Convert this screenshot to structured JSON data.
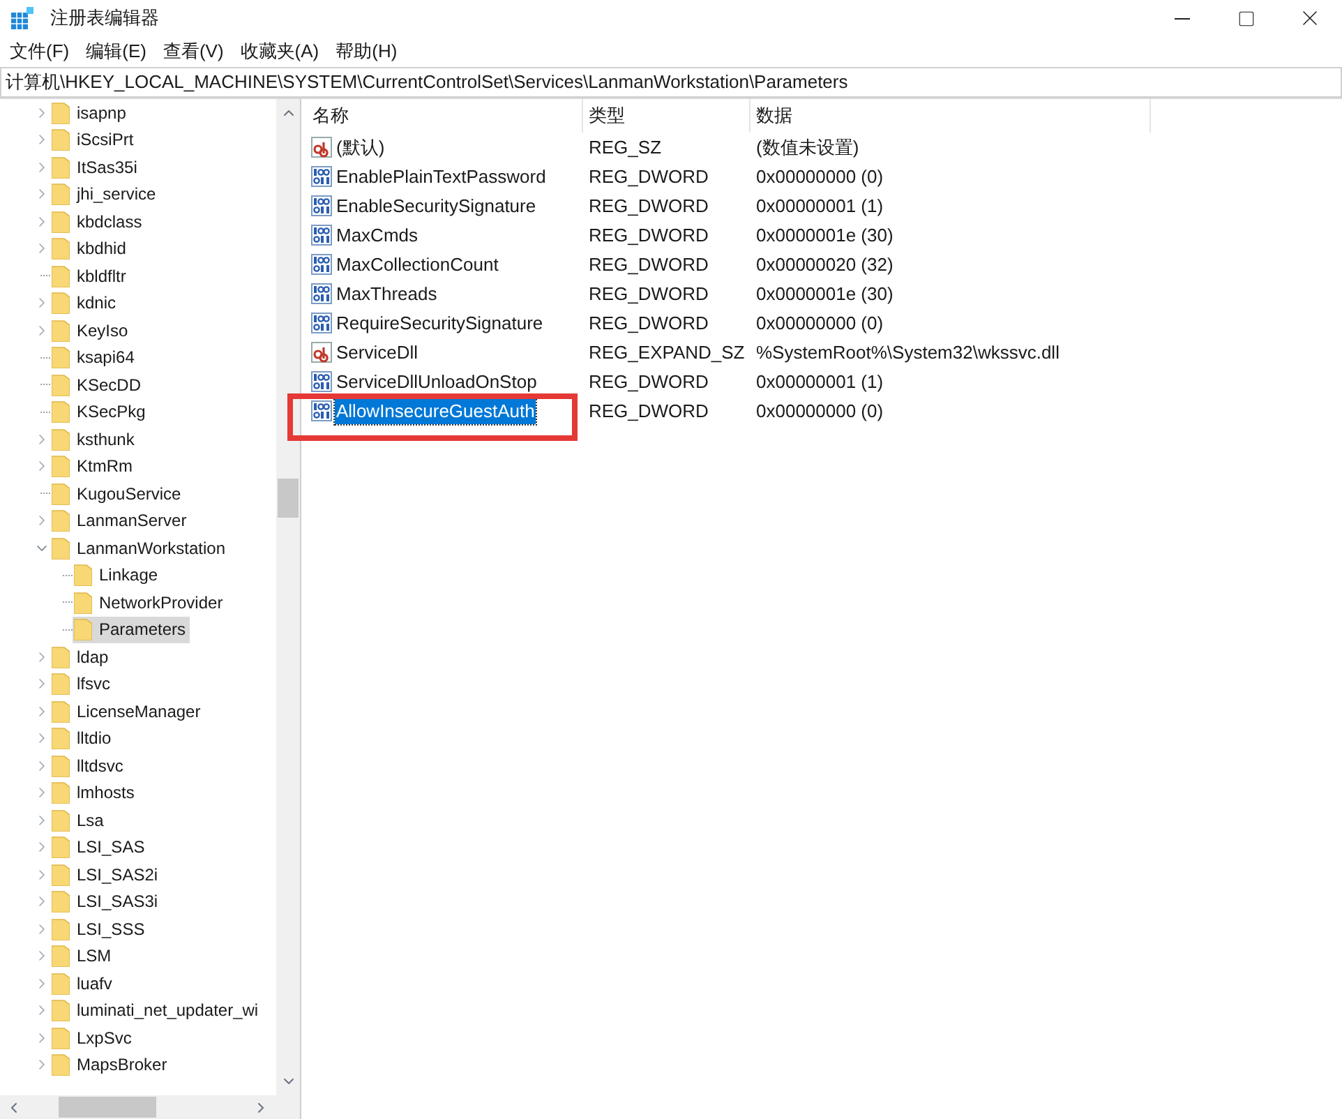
{
  "window": {
    "title": "注册表编辑器"
  },
  "menu": [
    "文件(F)",
    "编辑(E)",
    "查看(V)",
    "收藏夹(A)",
    "帮助(H)"
  ],
  "address": "计算机\\HKEY_LOCAL_MACHINE\\SYSTEM\\CurrentControlSet\\Services\\LanmanWorkstation\\Parameters",
  "tree": [
    {
      "label": "isapnp",
      "kind": "collapsed",
      "selected": false
    },
    {
      "label": "iScsiPrt",
      "kind": "collapsed",
      "selected": false
    },
    {
      "label": "ItSas35i",
      "kind": "collapsed",
      "selected": false
    },
    {
      "label": "jhi_service",
      "kind": "collapsed",
      "selected": false
    },
    {
      "label": "kbdclass",
      "kind": "collapsed",
      "selected": false
    },
    {
      "label": "kbdhid",
      "kind": "collapsed",
      "selected": false
    },
    {
      "label": "kbldfltr",
      "kind": "leaf",
      "selected": false
    },
    {
      "label": "kdnic",
      "kind": "collapsed",
      "selected": false
    },
    {
      "label": "KeyIso",
      "kind": "collapsed",
      "selected": false
    },
    {
      "label": "ksapi64",
      "kind": "leaf",
      "selected": false
    },
    {
      "label": "KSecDD",
      "kind": "leaf",
      "selected": false
    },
    {
      "label": "KSecPkg",
      "kind": "leaf",
      "selected": false
    },
    {
      "label": "ksthunk",
      "kind": "collapsed",
      "selected": false
    },
    {
      "label": "KtmRm",
      "kind": "collapsed",
      "selected": false
    },
    {
      "label": "KugouService",
      "kind": "leaf",
      "selected": false
    },
    {
      "label": "LanmanServer",
      "kind": "collapsed",
      "selected": false
    },
    {
      "label": "LanmanWorkstation",
      "kind": "expanded",
      "selected": false,
      "children": [
        {
          "label": "Linkage",
          "kind": "leaf",
          "selected": false
        },
        {
          "label": "NetworkProvider",
          "kind": "leaf",
          "selected": false
        },
        {
          "label": "Parameters",
          "kind": "leaf",
          "selected": true
        }
      ]
    },
    {
      "label": "ldap",
      "kind": "collapsed",
      "selected": false
    },
    {
      "label": "lfsvc",
      "kind": "collapsed",
      "selected": false
    },
    {
      "label": "LicenseManager",
      "kind": "collapsed",
      "selected": false
    },
    {
      "label": "lltdio",
      "kind": "collapsed",
      "selected": false
    },
    {
      "label": "lltdsvc",
      "kind": "collapsed",
      "selected": false
    },
    {
      "label": "lmhosts",
      "kind": "collapsed",
      "selected": false
    },
    {
      "label": "Lsa",
      "kind": "collapsed",
      "selected": false
    },
    {
      "label": "LSI_SAS",
      "kind": "collapsed",
      "selected": false
    },
    {
      "label": "LSI_SAS2i",
      "kind": "collapsed",
      "selected": false
    },
    {
      "label": "LSI_SAS3i",
      "kind": "collapsed",
      "selected": false
    },
    {
      "label": "LSI_SSS",
      "kind": "collapsed",
      "selected": false
    },
    {
      "label": "LSM",
      "kind": "collapsed",
      "selected": false
    },
    {
      "label": "luafv",
      "kind": "collapsed",
      "selected": false
    },
    {
      "label": "luminati_net_updater_wi",
      "kind": "collapsed",
      "selected": false
    },
    {
      "label": "LxpSvc",
      "kind": "collapsed",
      "selected": false
    },
    {
      "label": "MapsBroker",
      "kind": "collapsed",
      "selected": false
    }
  ],
  "table": {
    "columns": [
      "名称",
      "类型",
      "数据"
    ],
    "rows": [
      {
        "kind": "string",
        "name": "(默认)",
        "type": "REG_SZ",
        "data": "(数值未设置)",
        "selected": false,
        "annotated": false
      },
      {
        "kind": "binary",
        "name": "EnablePlainTextPassword",
        "type": "REG_DWORD",
        "data": "0x00000000 (0)",
        "selected": false,
        "annotated": false
      },
      {
        "kind": "binary",
        "name": "EnableSecuritySignature",
        "type": "REG_DWORD",
        "data": "0x00000001 (1)",
        "selected": false,
        "annotated": false
      },
      {
        "kind": "binary",
        "name": "MaxCmds",
        "type": "REG_DWORD",
        "data": "0x0000001e (30)",
        "selected": false,
        "annotated": false
      },
      {
        "kind": "binary",
        "name": "MaxCollectionCount",
        "type": "REG_DWORD",
        "data": "0x00000020 (32)",
        "selected": false,
        "annotated": false
      },
      {
        "kind": "binary",
        "name": "MaxThreads",
        "type": "REG_DWORD",
        "data": "0x0000001e (30)",
        "selected": false,
        "annotated": false
      },
      {
        "kind": "binary",
        "name": "RequireSecuritySignature",
        "type": "REG_DWORD",
        "data": "0x00000000 (0)",
        "selected": false,
        "annotated": false
      },
      {
        "kind": "string",
        "name": "ServiceDll",
        "type": "REG_EXPAND_SZ",
        "data": "%SystemRoot%\\System32\\wkssvc.dll",
        "selected": false,
        "annotated": false
      },
      {
        "kind": "binary",
        "name": "ServiceDllUnloadOnStop",
        "type": "REG_DWORD",
        "data": "0x00000001 (1)",
        "selected": false,
        "annotated": false
      },
      {
        "kind": "binary",
        "name": "AllowInsecureGuestAuth",
        "type": "REG_DWORD",
        "data": "0x00000000 (0)",
        "selected": true,
        "annotated": true
      }
    ]
  }
}
